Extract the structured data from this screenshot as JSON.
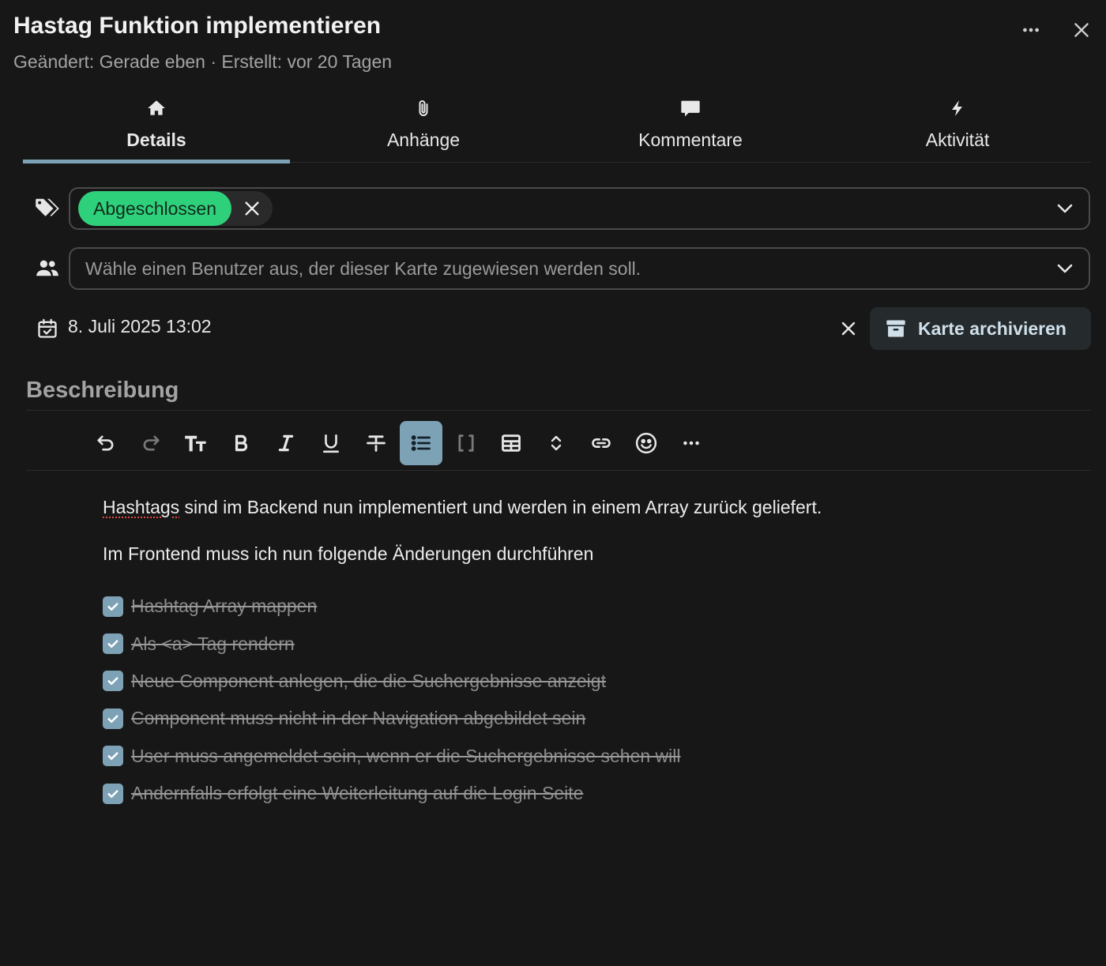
{
  "header": {
    "title": "Hastag Funktion implementieren",
    "meta": "Geändert: Gerade eben · Erstellt: vor 20 Tagen"
  },
  "tabs": [
    {
      "label": "Details",
      "icon": "home-icon",
      "active": true
    },
    {
      "label": "Anhänge",
      "icon": "paperclip-icon",
      "active": false
    },
    {
      "label": "Kommentare",
      "icon": "comment-icon",
      "active": false
    },
    {
      "label": "Aktivität",
      "icon": "bolt-icon",
      "active": false
    }
  ],
  "labels": {
    "selected": [
      {
        "label": "Abgeschlossen",
        "color": "#2fd07b"
      }
    ]
  },
  "assignee": {
    "placeholder": "Wähle einen Benutzer aus, der dieser Karte zugewiesen werden soll."
  },
  "due": {
    "date": "8. Juli 2025 13:02"
  },
  "archive": {
    "label": "Karte archivieren"
  },
  "description": {
    "title": "Beschreibung",
    "toolbar": [
      "undo-icon",
      "redo-icon",
      "text-size-icon",
      "bold-icon",
      "italic-icon",
      "underline-icon",
      "strikethrough-icon",
      "list-icon",
      "code-brackets-icon",
      "table-icon",
      "expand-icon",
      "link-icon",
      "emoji-icon",
      "more-icon"
    ],
    "paragraph1_word": "Hashtags",
    "paragraph1_rest": " sind im Backend nun implementiert und werden in einem Array zurück geliefert.",
    "paragraph2": "Im Frontend muss ich nun folgende Änderungen durchführen",
    "checklist": [
      {
        "text": "Hashtag Array mappen",
        "checked": true
      },
      {
        "text": "Als <a> Tag rendern",
        "checked": true
      },
      {
        "text": "Neue Component anlegen, die die Suchergebnisse anzeigt",
        "checked": true
      },
      {
        "text": "Component muss nicht in der Navigation abgebildet sein",
        "checked": true
      },
      {
        "text": "User muss angemeldet sein, wenn er die Suchergebnisse sehen will",
        "checked": true
      },
      {
        "text": "Andernfalls erfolgt eine Weiterleitung auf die Login Seite",
        "checked": true
      }
    ]
  },
  "colors": {
    "accent": "#7da2b6",
    "label_green": "#2fd07b",
    "background": "#171717"
  }
}
